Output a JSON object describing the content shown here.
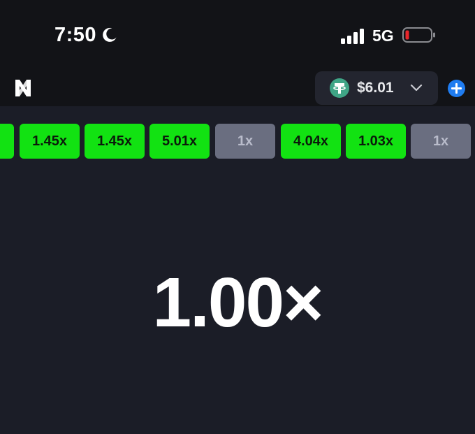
{
  "status_bar": {
    "time": "7:50",
    "network": "5G",
    "icons": [
      "moon-icon",
      "signal-icon",
      "battery-icon"
    ]
  },
  "header": {
    "logo_icon": "logo-icon",
    "wallet": {
      "currency_icon": "tether-icon",
      "balance": "$6.01",
      "dropdown_icon": "chevron-down-icon"
    },
    "add_button_icon": "plus-icon"
  },
  "history": [
    {
      "label": "x",
      "kind": "win"
    },
    {
      "label": "1.45x",
      "kind": "win"
    },
    {
      "label": "1.45x",
      "kind": "win"
    },
    {
      "label": "5.01x",
      "kind": "win"
    },
    {
      "label": "1x",
      "kind": "lose"
    },
    {
      "label": "4.04x",
      "kind": "win"
    },
    {
      "label": "1.03x",
      "kind": "win"
    },
    {
      "label": "1x",
      "kind": "lose"
    }
  ],
  "game": {
    "multiplier": "1.00×"
  },
  "colors": {
    "win": "#12e212",
    "lose": "#6a6e80",
    "accent": "#1f7cf0",
    "background": "#1b1d27",
    "battery_low": "#e8262b",
    "tether": "#3fa586"
  }
}
